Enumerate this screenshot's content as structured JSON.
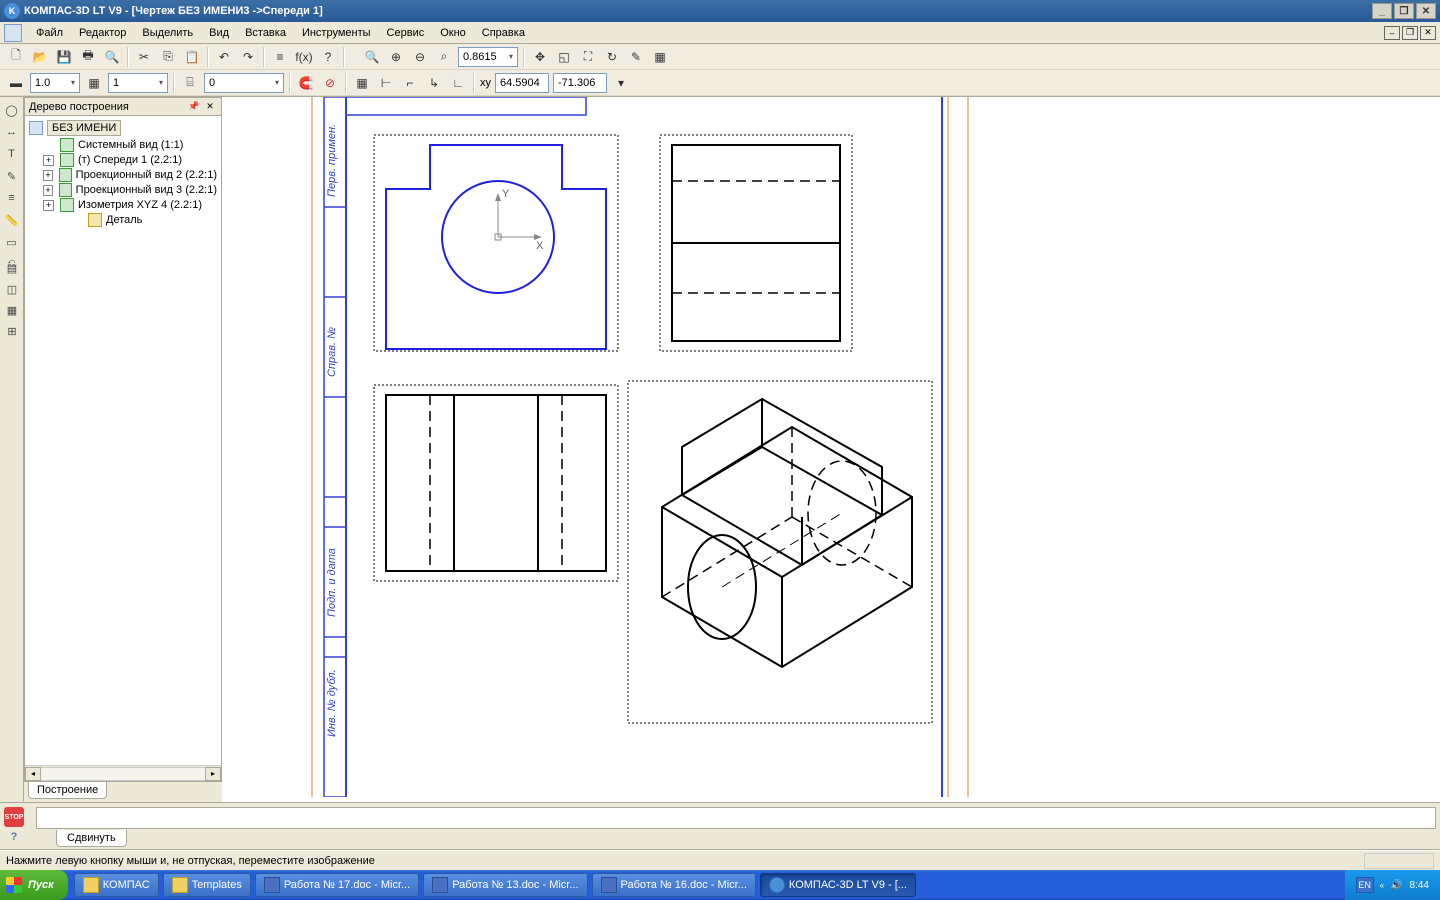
{
  "titlebar": {
    "text": "КОМПАС-3D LT V9 - [Чертеж БЕЗ ИМЕНИ3 ->Спереди 1]"
  },
  "menu": {
    "file": "Файл",
    "edit": "Редактор",
    "select": "Выделить",
    "view": "Вид",
    "insert": "Вставка",
    "tools": "Инструменты",
    "service": "Сервис",
    "window": "Окно",
    "help": "Справка"
  },
  "toolbar2": {
    "linewidth": "1.0",
    "layer": "1",
    "style": "0",
    "zoom": "0.8615",
    "coord_label": "x y",
    "coord_x": "64.5904",
    "coord_y": "-71.306"
  },
  "tree": {
    "title": "Дерево построения",
    "root": "БЕЗ ИМЕНИ",
    "items": [
      {
        "label": "Системный вид (1:1)",
        "exp": false,
        "iconclass": "green"
      },
      {
        "label": "(т) Спереди 1 (2.2:1)",
        "exp": true,
        "iconclass": "green"
      },
      {
        "label": "Проекционный вид 2 (2.2:1)",
        "exp": true,
        "iconclass": "green"
      },
      {
        "label": "Проекционный вид 3 (2.2:1)",
        "exp": true,
        "iconclass": "green"
      },
      {
        "label": "Изометрия XYZ 4 (2.2:1)",
        "exp": true,
        "iconclass": "green"
      }
    ],
    "detail": "Деталь"
  },
  "tab_below": "Построение",
  "bottom_tab": "Сдвинуть",
  "statusbar": "Нажмите левую кнопку мыши и, не отпуская, переместите изображение",
  "taskbar": {
    "start": "Пуск",
    "items": [
      {
        "label": "КОМПАС",
        "icon": "folder"
      },
      {
        "label": "Templates",
        "icon": "folder"
      },
      {
        "label": "Работа № 17.doc - Micr...",
        "icon": "word"
      },
      {
        "label": "Работа № 13.doc - Micr...",
        "icon": "word"
      },
      {
        "label": "Работа № 16.doc - Micr...",
        "icon": "word"
      },
      {
        "label": "КОМПАС-3D LT V9 - [...",
        "icon": "kompas",
        "active": true
      }
    ],
    "lang": "EN",
    "clock": "8:44"
  }
}
